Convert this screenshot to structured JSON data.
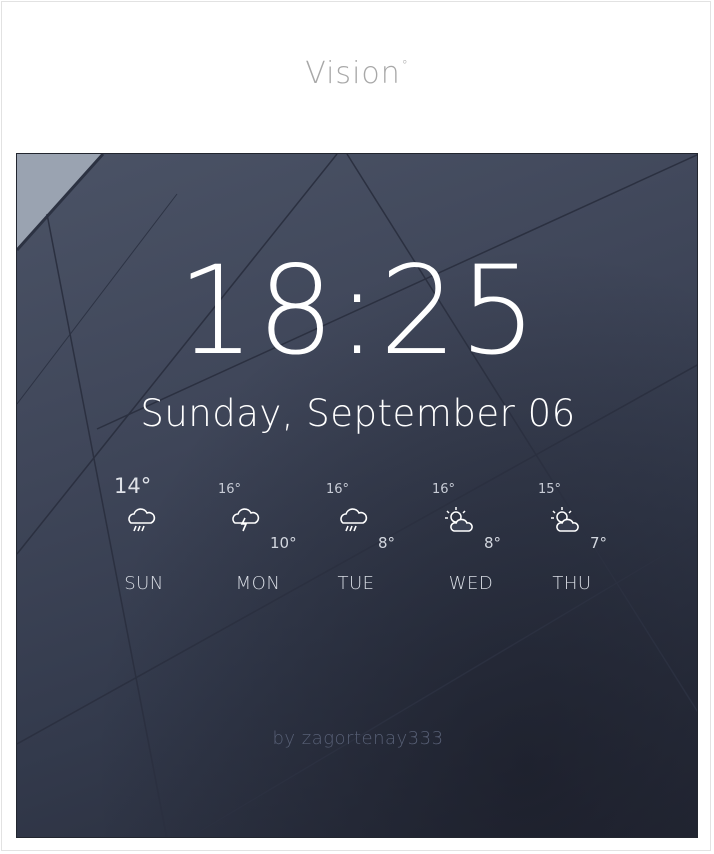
{
  "app": {
    "title": "Vision",
    "title_mark": "°"
  },
  "widget": {
    "time": "18:25",
    "date": "Sunday, September 06",
    "credit": "by zagortenay333"
  },
  "forecast": [
    {
      "day": "SUN",
      "high": "14°",
      "low": "",
      "icon": "rain-cloud-icon"
    },
    {
      "day": "MON",
      "high": "16°",
      "low": "10°",
      "icon": "thunder-cloud-icon"
    },
    {
      "day": "TUE",
      "high": "16°",
      "low": "8°",
      "icon": "rain-cloud-icon"
    },
    {
      "day": "WED",
      "high": "16°",
      "low": "8°",
      "icon": "partly-cloudy-icon"
    },
    {
      "day": "THU",
      "high": "15°",
      "low": "7°",
      "icon": "partly-cloudy-icon"
    }
  ],
  "colors": {
    "text_primary": "#ffffff",
    "background_dark": "#3a4154",
    "title_gray": "#a8a8a8"
  }
}
